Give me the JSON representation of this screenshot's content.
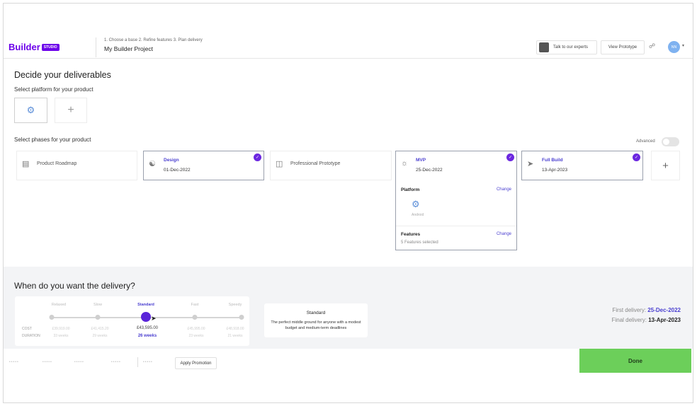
{
  "header": {
    "logo_text": "Builder",
    "logo_tag": "STUDIO",
    "steps": "1. Choose a base  2. Refine features  3. Plan delivery",
    "project_name": "My Builder Project",
    "experts_label": "Talk to our experts",
    "prototype_label": "View Prototype",
    "user_initials": "NN"
  },
  "main": {
    "title": "Decide your deliverables",
    "platform_label": "Select platform for your product",
    "phases_label": "Select phases for your product",
    "advanced_label": "Advanced",
    "advanced_on": false
  },
  "phases": [
    {
      "name": "Product Roadmap",
      "date": "",
      "selected": false,
      "icon": "document-icon"
    },
    {
      "name": "Design",
      "date": "01-Dec-2022",
      "selected": true,
      "icon": "palette-icon"
    },
    {
      "name": "Professional Prototype",
      "date": "",
      "selected": false,
      "icon": "prototype-icon"
    },
    {
      "name": "MVP",
      "date": "25-Dec-2022",
      "selected": true,
      "icon": "bulb-icon"
    },
    {
      "name": "Full Build",
      "date": "13-Apr-2023",
      "selected": true,
      "icon": "rocket-icon"
    }
  ],
  "mvp_details": {
    "platform_label": "Platform",
    "change_label": "Change",
    "platform_name": "Android",
    "features_label": "Features",
    "features_selected": "5 Features selected"
  },
  "delivery": {
    "title": "When do you want the delivery?",
    "speeds": [
      "Relaxed",
      "Slow",
      "Standard",
      "Fast",
      "Speedy"
    ],
    "active_index": 2,
    "cost_label": "COST",
    "duration_label": "DURATION",
    "costs": [
      "£39,919.00",
      "£41,415.20",
      "£43,595.00",
      "£45,995.00",
      "£48,918.00"
    ],
    "durations": [
      "33 weeks",
      "29 weeks",
      "26 weeks",
      "23 weeks",
      "21 weeks"
    ],
    "desc_title": "Standard",
    "desc_text": "The perfect middle ground for anyone with a modest budget and medium-term deadlines",
    "first_label": "First delivery:",
    "first_date": "25-Dec-2022",
    "final_label": "Final delivery:",
    "final_date": "13-Apr-2023"
  },
  "footer": {
    "promo_dots": [
      "•••••",
      "•••••",
      "•••••",
      "•••••",
      "•••••"
    ],
    "apply_label": "Apply Promotion",
    "done_label": "Done"
  },
  "colors": {
    "brand": "#6c00ea",
    "accent": "#5a25d9",
    "done": "#6ccf5a"
  }
}
